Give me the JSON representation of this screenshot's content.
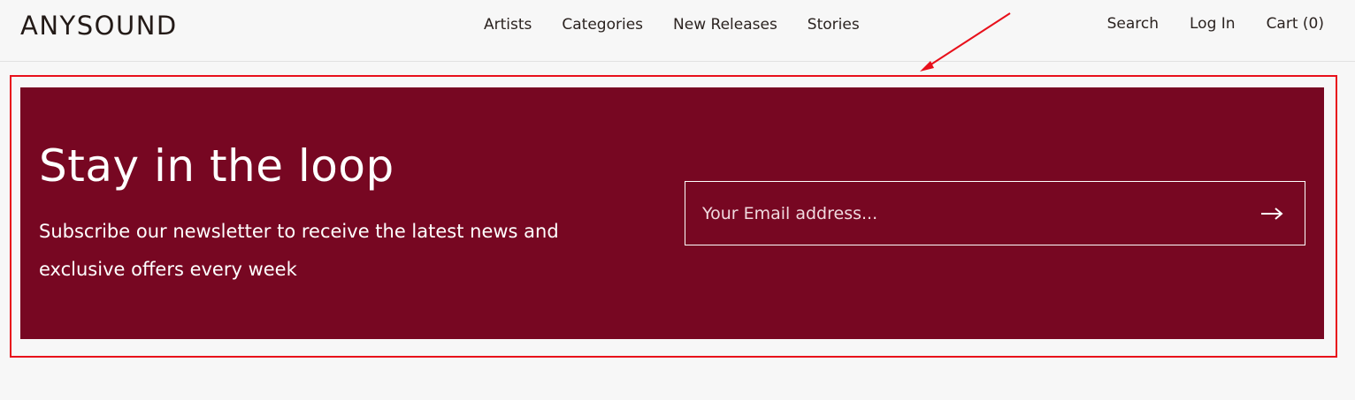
{
  "header": {
    "logo": "ANYSOUND",
    "nav": [
      "Artists",
      "Categories",
      "New Releases",
      "Stories"
    ],
    "utility": {
      "search": "Search",
      "login": "Log In",
      "cart": "Cart (0)"
    }
  },
  "newsletter": {
    "title": "Stay in the loop",
    "subtitle": "Subscribe our newsletter to receive the latest news and exclusive offers every week",
    "email_placeholder": "Your Email address...",
    "submit_icon": "arrow-right-icon",
    "background_color": "#770722"
  },
  "annotation": {
    "highlight_color": "#e8101b"
  }
}
